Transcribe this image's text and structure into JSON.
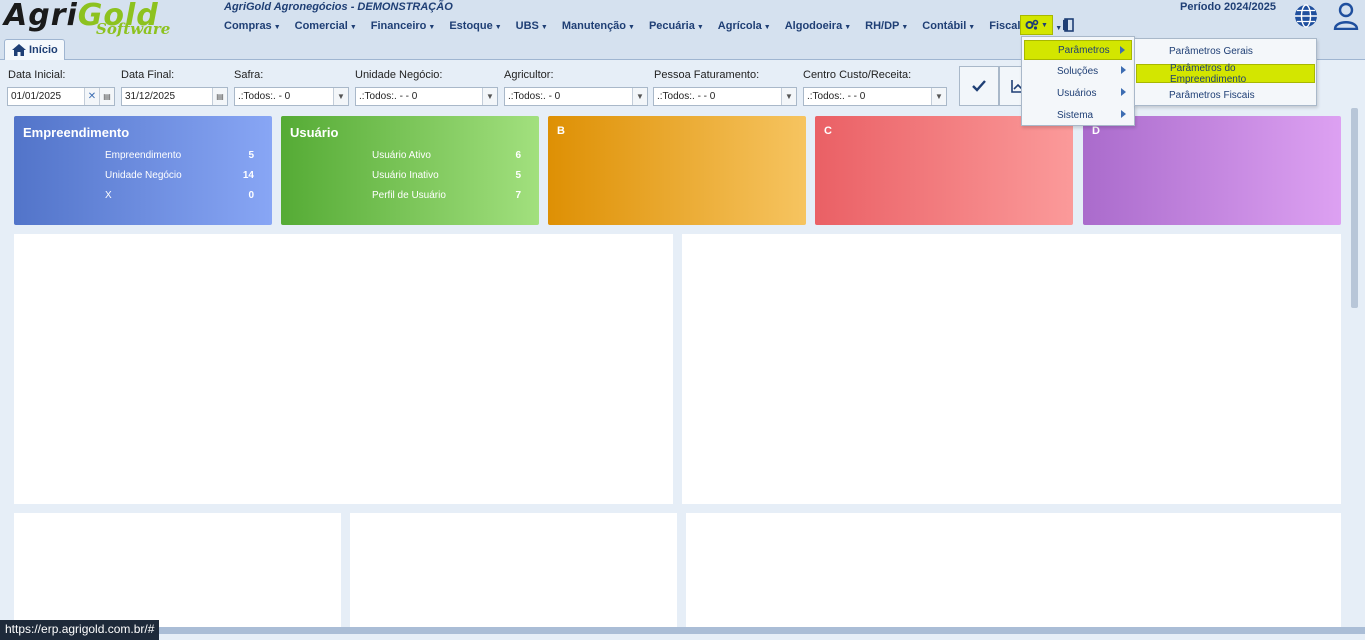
{
  "header": {
    "logo_top": "AgriGold",
    "logo_bottom": "Software",
    "company": "AgriGold Agronegócios - DEMONSTRAÇÃO",
    "period": "Período 2024/2025"
  },
  "menu": [
    {
      "label": "Compras"
    },
    {
      "label": "Comercial"
    },
    {
      "label": "Financeiro"
    },
    {
      "label": "Estoque"
    },
    {
      "label": "UBS"
    },
    {
      "label": "Manutenção"
    },
    {
      "label": "Pecuária"
    },
    {
      "label": "Agrícola"
    },
    {
      "label": "Algodoeira"
    },
    {
      "label": "RH/DP"
    },
    {
      "label": "Contábil"
    },
    {
      "label": "Fiscal"
    },
    {
      "label": "☰"
    }
  ],
  "tab": {
    "label": "Início"
  },
  "filters": {
    "data_inicial": {
      "label": "Data Inicial:",
      "value": "01/01/2025"
    },
    "data_final": {
      "label": "Data Final:",
      "value": "31/12/2025"
    },
    "safra": {
      "label": "Safra:",
      "value": ".:Todos:. - 0"
    },
    "unidade": {
      "label": "Unidade Negócio:",
      "value": ".:Todos:. -  - 0"
    },
    "agricultor": {
      "label": "Agricultor:",
      "value": ".:Todos:. - 0"
    },
    "pessoa": {
      "label": "Pessoa Faturamento:",
      "value": ".:Todos:. -  - 0"
    },
    "centro": {
      "label": "Centro Custo/Receita:",
      "value": ".:Todos:. -  - 0"
    }
  },
  "cards": [
    {
      "title": "Empreendimento",
      "rows": [
        {
          "label": "Empreendimento",
          "value": "5"
        },
        {
          "label": "Unidade Negócio",
          "value": "14"
        },
        {
          "label": "X",
          "value": "0"
        }
      ]
    },
    {
      "title": "Usuário",
      "rows": [
        {
          "label": "Usuário Ativo",
          "value": "6"
        },
        {
          "label": "Usuário Inativo",
          "value": "5"
        },
        {
          "label": "Perfil de Usuário",
          "value": "7"
        }
      ]
    },
    {
      "title": "B"
    },
    {
      "title": "C"
    },
    {
      "title": "D"
    }
  ],
  "config_menu": {
    "items": [
      "Parâmetros",
      "Soluções",
      "Usuários",
      "Sistema"
    ],
    "submenu": [
      "Parâmetros Gerais",
      "Parâmetros do Empreendimento",
      "Parâmetros Fiscais"
    ]
  },
  "status_url": "https://erp.agrigold.com.br/#",
  "colors": {
    "highlight": "#d3e600",
    "menu_text": "#1f3f75",
    "card_empreendimento": "#5b7fd4",
    "card_usuario": "#5fb33f",
    "card_b": "#e0960a",
    "card_c": "#ec6a6e",
    "card_d": "#b678d2"
  }
}
